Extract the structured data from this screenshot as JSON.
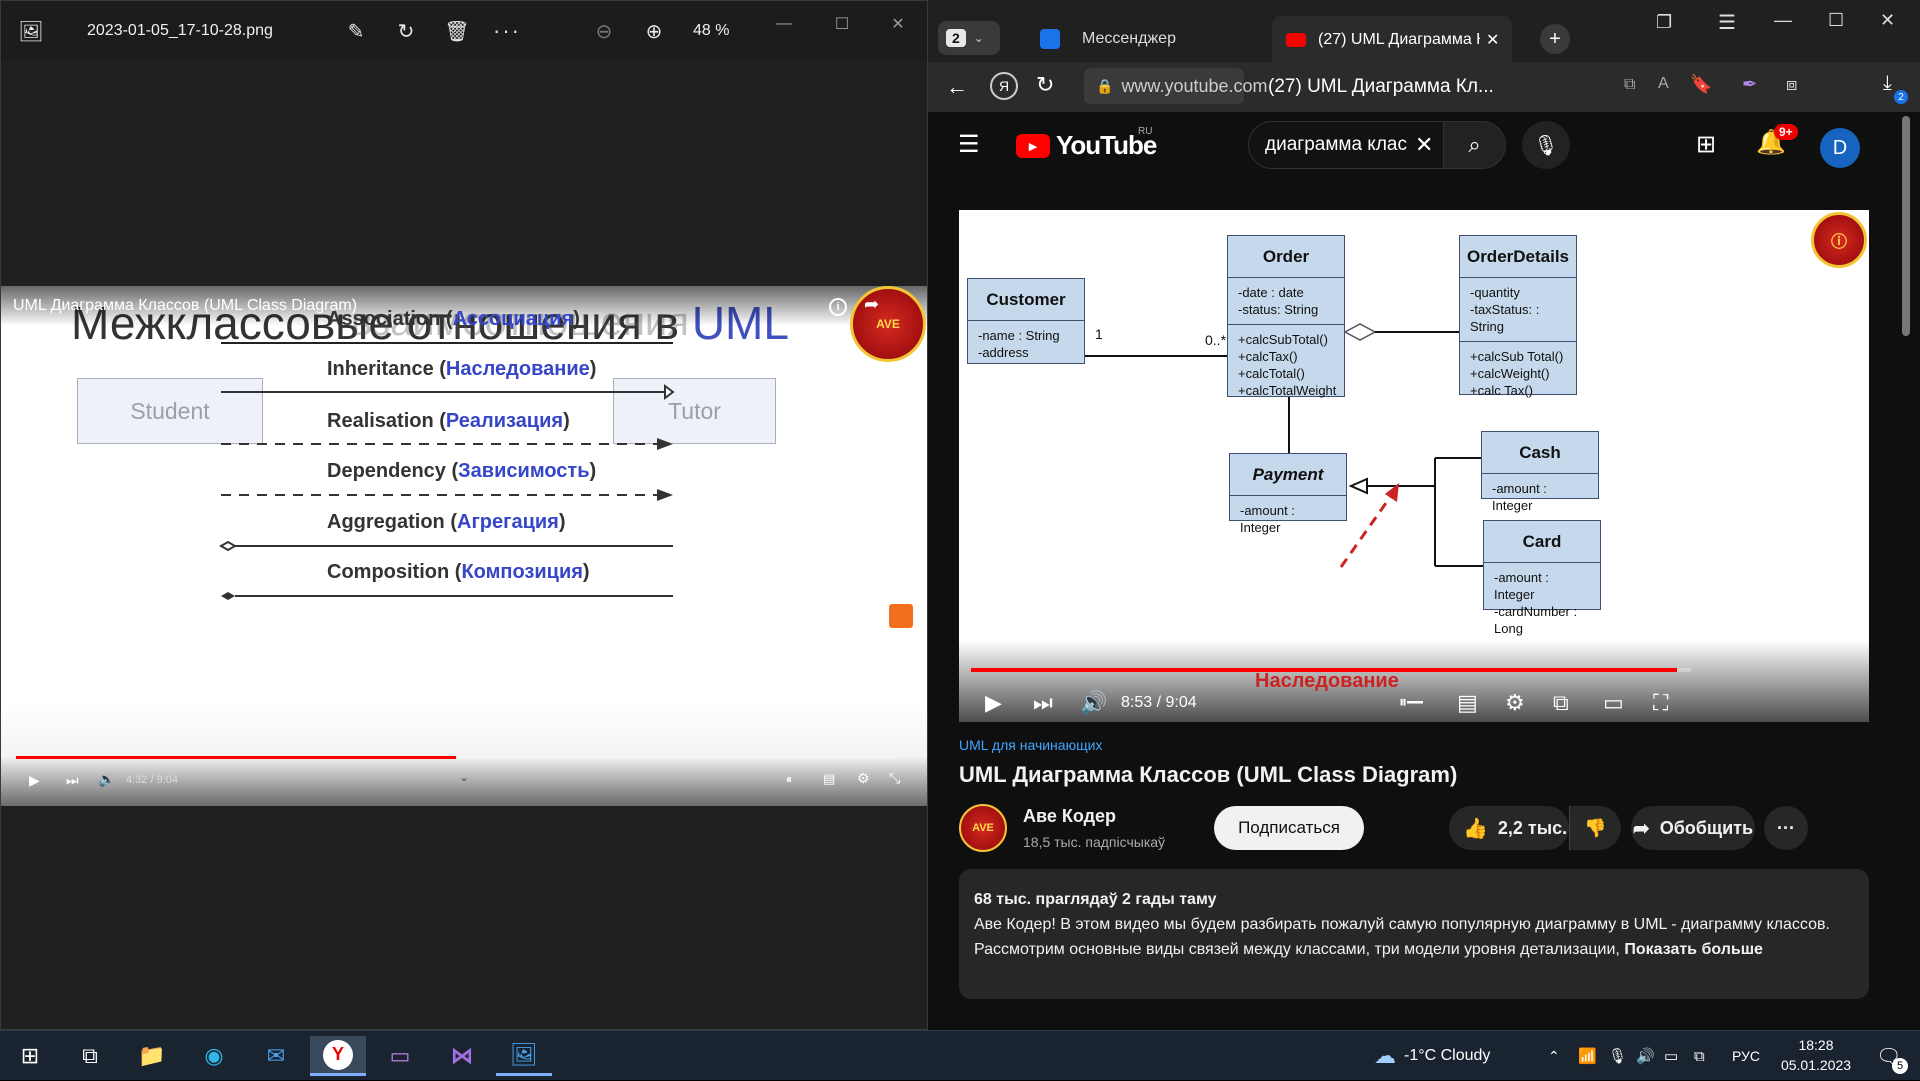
{
  "photos": {
    "filename": "2023-01-05_17-10-28.png",
    "zoom": "48 %",
    "video_title": "UML Диаграмма Классов (UML Class Diagram)",
    "slide_heading": "Межклассовые отношения в",
    "slide_heading_accent": "UML",
    "overlay_heading_fragment": "взаимоотношения",
    "box_left": "Student",
    "box_right": "Tutor",
    "relations": [
      {
        "en": "Association",
        "ru": "Ассоциация"
      },
      {
        "en": "Inheritance",
        "ru": "Наследование"
      },
      {
        "en": "Realisation",
        "ru": "Реализация"
      },
      {
        "en": "Dependency",
        "ru": "Зависимость"
      },
      {
        "en": "Aggregation",
        "ru": "Агрегация"
      },
      {
        "en": "Composition",
        "ru": "Композиция"
      }
    ],
    "time": "4:32 / 9:04",
    "progress": 0.5
  },
  "browser": {
    "tab_count": "2",
    "tabs": [
      {
        "label": "Мессенджер"
      },
      {
        "label": "(27) UML Диаграмма Кл"
      }
    ],
    "url_domain": "www.youtube.com",
    "page_title": "(27) UML Диаграмма Кл...",
    "downloads_badge": "2"
  },
  "youtube": {
    "logo_text": "YouTube",
    "region": "RU",
    "search_query": "диаграмма клас",
    "notifications_badge": "9+",
    "avatar_letter": "D"
  },
  "diagram": {
    "classes": [
      {
        "name": "Customer",
        "attrs": [
          "-name : String",
          "-address"
        ],
        "ops": []
      },
      {
        "name": "Order",
        "attrs": [
          "-date : date",
          "-status: String"
        ],
        "ops": [
          "+calcSubTotal()",
          "+calcTax()",
          "+calcTotal()",
          "+calcTotalWeight"
        ]
      },
      {
        "name": "OrderDetails",
        "attrs": [
          "-quantity",
          "-taxStatus: : String"
        ],
        "ops": [
          "+calcSub Total()",
          "+calcWeight()",
          "+calc Tax()"
        ]
      },
      {
        "name": "Payment",
        "attrs": [
          "-amount : Integer"
        ],
        "ops": []
      },
      {
        "name": "Cash",
        "attrs": [
          "-amount : Integer"
        ],
        "ops": []
      },
      {
        "name": "Card",
        "attrs": [
          "-amount : Integer",
          "-cardNumber : Long"
        ],
        "ops": []
      }
    ],
    "multiplicity_left": "1",
    "multiplicity_right": "0..*",
    "annotation": "Наследование"
  },
  "player": {
    "time": "8:53 / 9:04",
    "progress": 0.98
  },
  "video": {
    "hashtag": "UML для начинающих",
    "title": "UML Диаграмма Классов (UML Class Diagram)",
    "channel": "Аве Кодер",
    "subscribers": "18,5 тыс. падпісчыкаў",
    "subscribe_label": "Подписаться",
    "likes": "2,2 тыс.",
    "share_label": "Обобщить",
    "views_age": "68 тыс. праглядаў  2 гады таму",
    "description_1": "Аве Кодер! В этом видео мы будем разбирать пожалуй самую популярную диаграмму  в UML - диаграмму классов.",
    "description_2": "Рассмотрим основные виды связей между классами, три модели уровня детализации,",
    "show_more": "Показать больше"
  },
  "taskbar": {
    "weather": "-1°C  Cloudy",
    "lang": "РУС",
    "time": "18:28",
    "date": "05.01.2023",
    "notif_count": "5"
  },
  "colors": {
    "yt_red": "#ff0000",
    "relation_ru": "#3646c8",
    "uml_class_fill": "#c6d9ec",
    "inheritance_arrow": "#cc2222"
  }
}
